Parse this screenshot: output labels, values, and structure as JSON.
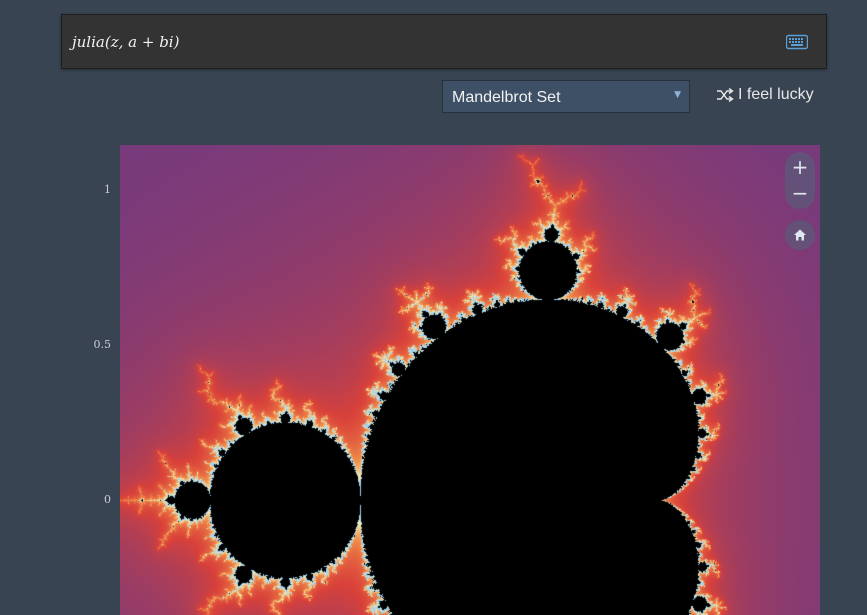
{
  "formula": {
    "expression": "julia(z, a + bi)"
  },
  "preset_select": {
    "selected": "Mandelbrot Set"
  },
  "lucky_button": {
    "label": "I feel lucky"
  },
  "plot": {
    "y_ticks": [
      "1",
      "0.5",
      "0"
    ],
    "fractal": "mandelbrot",
    "view": {
      "re_min": -1.55,
      "re_max": 0.78,
      "im_top": 1.15,
      "im_bottom": -0.37
    },
    "palette": [
      "#3b3a8f",
      "#7a3a7a",
      "#d9413a",
      "#f08a48",
      "#fde9a8",
      "#9fd2f0",
      "#000000"
    ]
  },
  "zoom": {
    "in_label": "+",
    "out_label": "−"
  },
  "icons": [
    "keyboard-icon",
    "shuffle-icon",
    "home-icon",
    "zoom-in-icon",
    "zoom-out-icon"
  ]
}
